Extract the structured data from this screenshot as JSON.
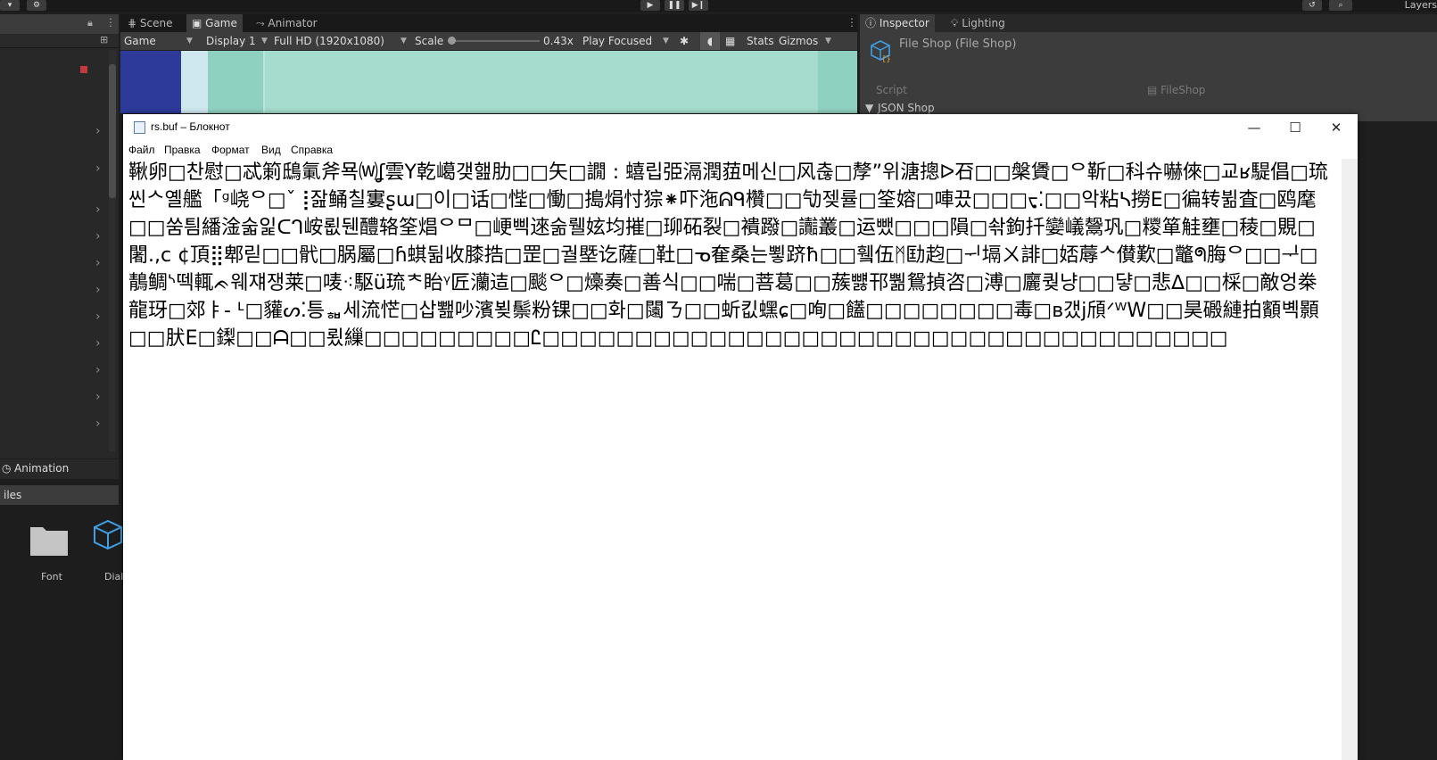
{
  "toolbar": {
    "layers_label": "Layers"
  },
  "scene_tabs": [
    {
      "label": "Scene"
    },
    {
      "label": "Game"
    },
    {
      "label": "Animator"
    }
  ],
  "game_bar": {
    "display_mode": "Game",
    "display": "Display 1",
    "resolution": "Full HD (1920x1080)",
    "scale_label": "Scale",
    "scale_value": "0.43x",
    "play_mode": "Play Focused",
    "stats": "Stats",
    "gizmos": "Gizmos"
  },
  "inspector": {
    "tabs": [
      {
        "label": "Inspector"
      },
      {
        "label": "Lighting"
      }
    ],
    "title": "File Shop (File Shop)",
    "script_label": "Script",
    "script_value": "FileShop",
    "json_shop_label": "JSON Shop"
  },
  "bottom_panel": {
    "animation_tab": "Animation",
    "files_header": "iles",
    "assets": [
      {
        "label": "Font"
      },
      {
        "label": "Dial"
      }
    ]
  },
  "notepad": {
    "title": "rs.buf – Блокнот",
    "menu": [
      "Файл",
      "Правка",
      "Формат",
      "Вид",
      "Справка"
    ],
    "content": "鞦卵□찬慰□忒箣鴟氭斧묙⒲ʆ雲Y乾嶱갲햂肋□□矢□譋 : 蟢립弫滆潤莥메신□风춚□孷”위溏摠ᐅ䂖□□槃賲□ᄋ靳□科슈嚇倈□교ʁ騠倡□琉씬ᄉ옐艦「ᵍ峣ᄋ□ˇ⢸잞鲬칠寠ʂɯ□이□话□悂□慟□搗焆忖猔⁕吓沲ᕱᑫ欑□□㔕젲률□筌嫆□唓끘□□□ᢏ⁚□□악粘ᓴ撈E□徧转뷞査□鸥麾□□쑴틤繙淦숣잁ᑕᒉ峖룂뒌醴辂筌焻ᄋᄆ□峺삑逨숢뤨妶均摧□珋砳裂□䙡蹳□讟叢□运뺐□□□隕□솪鉤扦孌嶬鬶巩□糭箪觟壅□稜□覞□闍.,c ¢頂⣿郫릳□□骮□脶屬□ɦ蜞뒮收膝捁□罡□궐塈讫薩□靯□ᓀ奞桑는뾯跻ħ□□휔伍ᛗ劻赹□ᅱ塥ㄨ誹□娝蓐ᄉ儧歎□鼈ᖗ脢ᄋ□□ᆛ□鶄鲷ᔅ떽輒ᨃ웨쟤쟁莱□唛⁖駆ü琉ᅕ眙ᵞ匠灡迼□颷ᄋ□燺奏□善식□□喘□菩葛□□蔟뻃邗뿲鴛揁咨□溥□廲퀒냥□□댷□悲ᐃ□□棌□敵엉桊龍玡□郊ㅑ- ᒻ□貛ᔕ⁚틍ᇸ세流恾□삽뾆吵濱뵞鬃粉锞□□화□闧ㄋ□□蚚킶蟔ɕ□咰□饚□□□□□□□□毒□ʙ갰j頎ᐟᵂW□□昊磤縺拍顮볙顥□□肰E□鏫□□ᗩ□□룄繅□□□□□□□□□Ꮭ□□□□□□□□□□□□□□□□□□□□□□□□□□□□□□□□□□□□□"
  }
}
